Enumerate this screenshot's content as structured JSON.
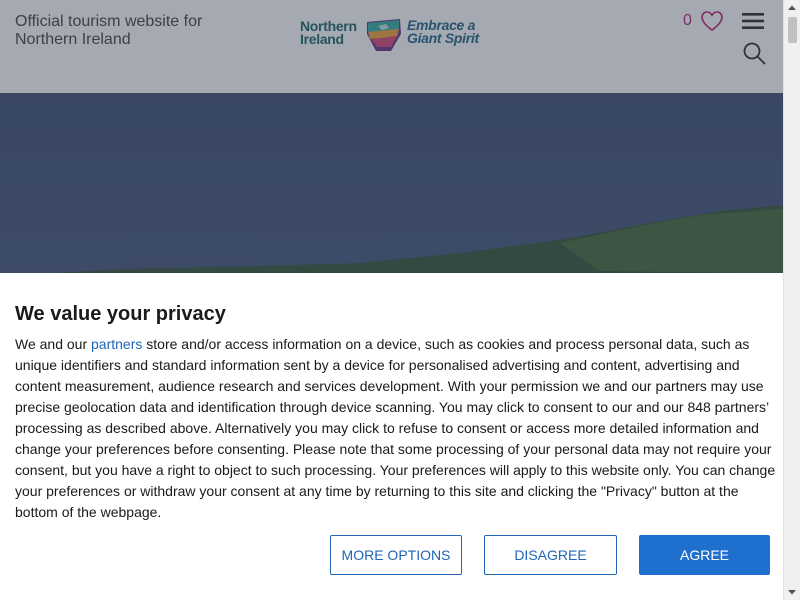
{
  "header": {
    "tagline": "Official tourism website for Northern Ireland",
    "logo_left": "Northern Ireland",
    "logo_right": "Embrace a Giant Spirit",
    "favourites_count": "0",
    "icons": [
      "heart-icon",
      "menu-icon",
      "search-icon"
    ]
  },
  "consent": {
    "title": "We value your privacy",
    "body_before_link": "We and our ",
    "link_text": "partners",
    "body_after_link": " store and/or access information on a device, such as cookies and process personal data, such as unique identifiers and standard information sent by a device for personalised advertising and content, advertising and content measurement, audience research and services development. With your permission we and our partners may use precise geolocation data and identification through device scanning. You may click to consent to our and our 848 partners’ processing as described above. Alternatively you may click to refuse to consent or access more detailed information and change your preferences before consenting. Please note that some processing of your personal data may not require your consent, but you have a right to object to such processing. Your preferences will apply to this website only. You can change your preferences or withdraw your consent at any time by returning to this site and clicking the \"Privacy\" button at the bottom of the webpage.",
    "buttons": {
      "more_options": "MORE OPTIONS",
      "disagree": "DISAGREE",
      "agree": "AGREE"
    }
  },
  "colors": {
    "accent": "#1f6fcf",
    "link": "#1f66b8",
    "favourite": "#c0287a"
  }
}
